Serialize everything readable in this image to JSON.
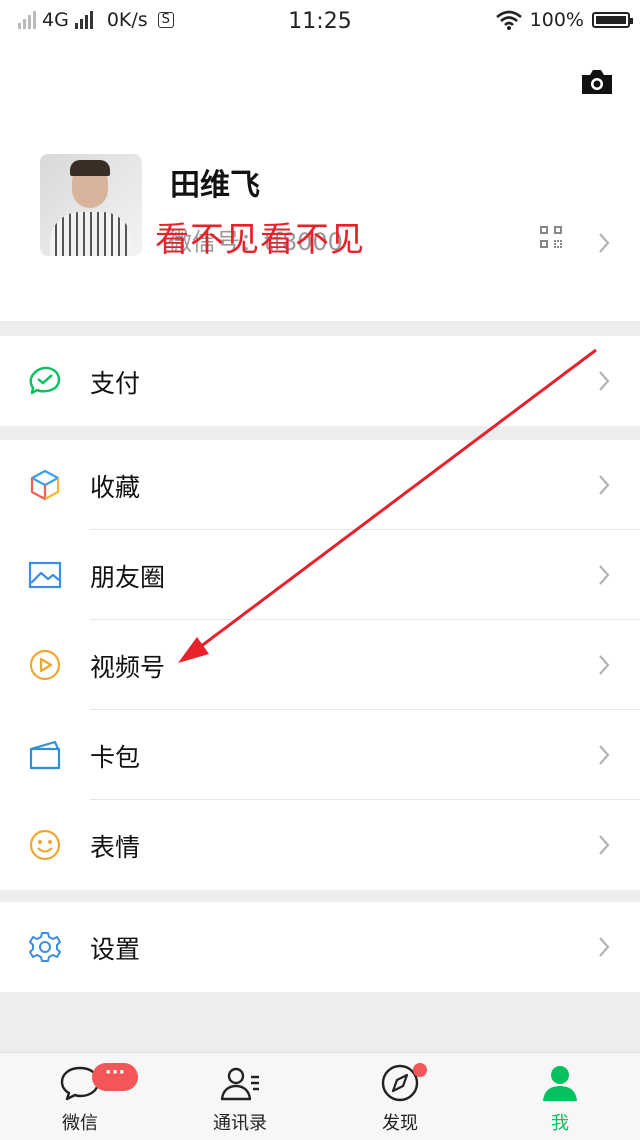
{
  "status_bar": {
    "network": "4G",
    "speed": "0K/s",
    "sim_badge": "S",
    "time": "11:25",
    "battery": "100%"
  },
  "profile": {
    "name": "田维飞",
    "wechat_id": "微信号：tf8000",
    "overlay_text": "看不见看不见"
  },
  "menu": {
    "pay": {
      "label": "支付",
      "icon": "wechat-pay-icon"
    },
    "favorites": {
      "label": "收藏",
      "icon": "cube-icon"
    },
    "moments": {
      "label": "朋友圈",
      "icon": "image-icon"
    },
    "channels": {
      "label": "视频号",
      "icon": "play-circle-icon"
    },
    "cards": {
      "label": "卡包",
      "icon": "card-icon"
    },
    "stickers": {
      "label": "表情",
      "icon": "smile-icon"
    },
    "settings": {
      "label": "设置",
      "icon": "gear-icon"
    }
  },
  "tabbar": {
    "chats": {
      "label": "微信",
      "badge": "···"
    },
    "contacts": {
      "label": "通讯录"
    },
    "discover": {
      "label": "发现"
    },
    "me": {
      "label": "我"
    }
  },
  "colors": {
    "accent_green": "#07c160",
    "badge_red": "#f25658",
    "annotation_red": "#e8212b"
  }
}
